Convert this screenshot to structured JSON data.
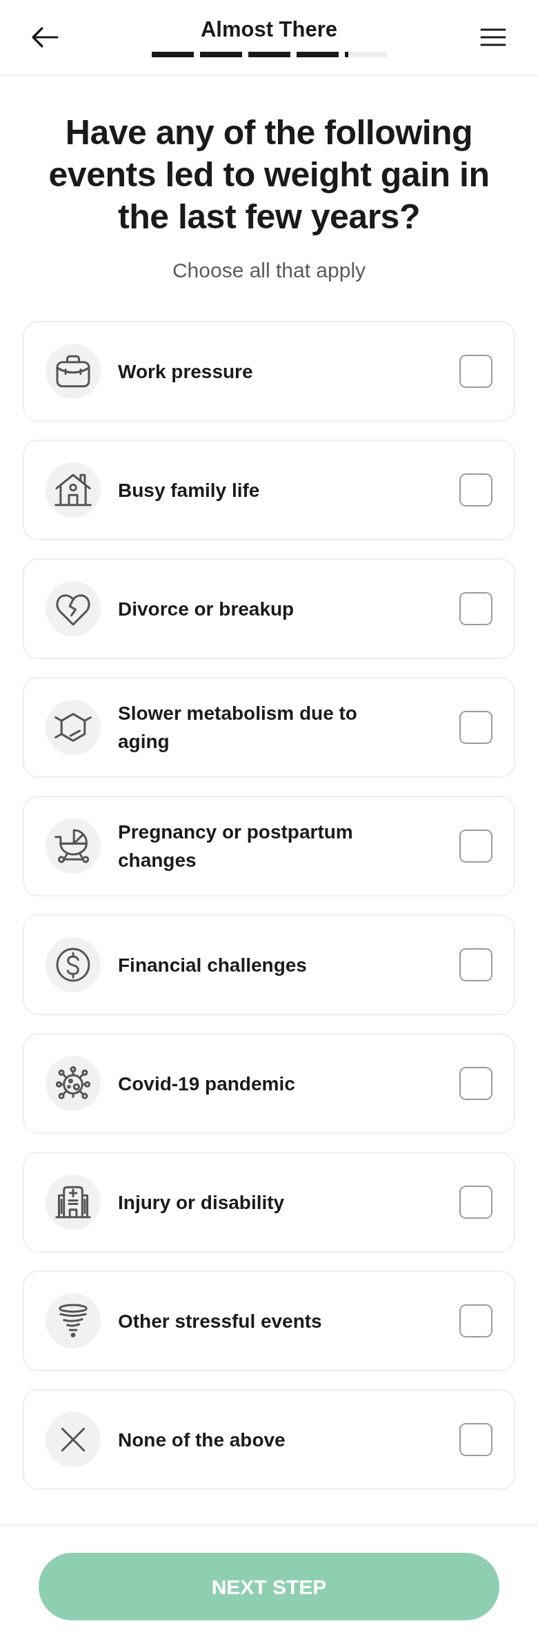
{
  "header": {
    "title": "Almost There",
    "progress": {
      "level": 0.836
    }
  },
  "question": {
    "title": "Have any of the following events led to weight gain in the last few years?",
    "subtitle": "Choose all that apply"
  },
  "options": [
    {
      "label": "Work pressure",
      "checked": false
    },
    {
      "label": "Busy family life",
      "checked": false
    },
    {
      "label": "Divorce or breakup",
      "checked": false
    },
    {
      "label": "Slower metabolism due to aging",
      "checked": false
    },
    {
      "label": "Pregnancy or postpartum changes",
      "checked": false
    },
    {
      "label": "Financial challenges",
      "checked": false
    },
    {
      "label": "Covid-19 pandemic",
      "checked": false
    },
    {
      "label": "Injury or disability",
      "checked": false
    },
    {
      "label": "Other stressful events",
      "checked": false
    },
    {
      "label": "None of the above",
      "checked": false
    }
  ],
  "next_button": {
    "label": "NEXT STEP",
    "disabled": true
  }
}
